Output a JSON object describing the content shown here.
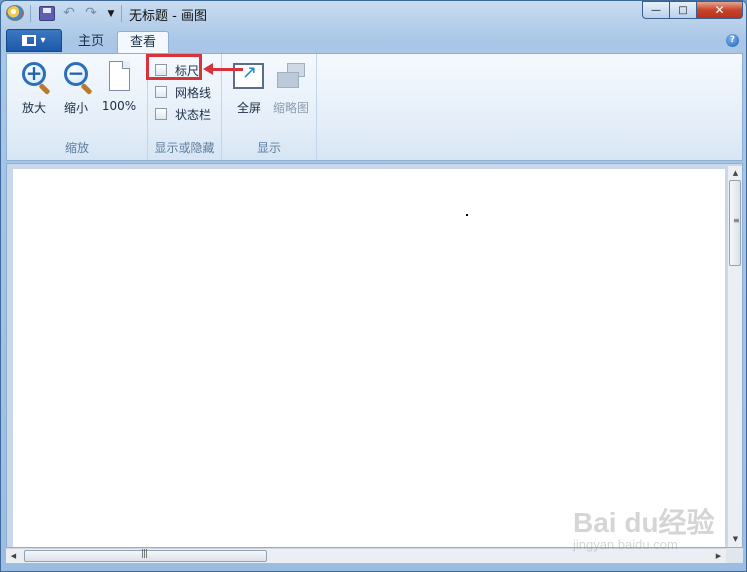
{
  "window": {
    "title": "无标题 - 画图"
  },
  "quick_access": {
    "undo_glyph": "↶",
    "redo_glyph": "↷",
    "more_glyph": "▼"
  },
  "caption": {
    "minimize_glyph": "—",
    "maximize_glyph": "□",
    "close_glyph": "✕"
  },
  "tabs": {
    "app_menu_arrow": "▾",
    "home": "主页",
    "view": "查看",
    "help_glyph": "?"
  },
  "ribbon": {
    "zoom_group": {
      "title": "缩放",
      "zoom_in": "放大",
      "zoom_out": "缩小",
      "zoom_100": "100%",
      "plus_sign": "+",
      "minus_sign": "−"
    },
    "showhide_group": {
      "title": "显示或隐藏",
      "ruler": "标尺",
      "gridlines": "网格线",
      "statusbar": "状态栏",
      "ruler_checked": false,
      "gridlines_checked": false,
      "statusbar_checked": false
    },
    "display_group": {
      "title": "显示",
      "fullscreen": "全屏",
      "thumbnail": "缩略图"
    }
  },
  "scrollbars": {
    "up_glyph": "▲",
    "down_glyph": "▼",
    "left_glyph": "◀",
    "right_glyph": "▶",
    "v_grip": "≡",
    "h_grip": "|||"
  },
  "watermark": {
    "logo": "Bai du经验",
    "url": "jingyan.baidu.com"
  },
  "colors": {
    "highlight": "#d8323a",
    "accent": "#1e58a8"
  }
}
